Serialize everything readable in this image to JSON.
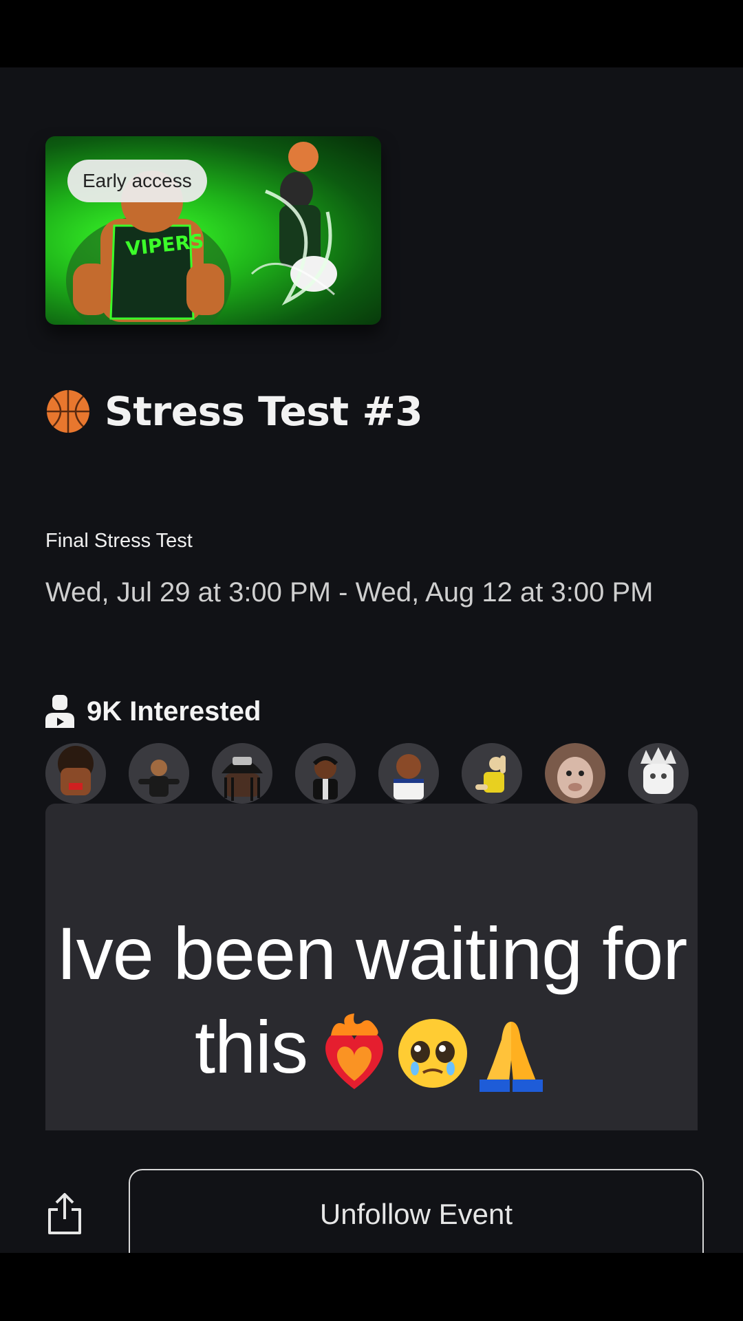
{
  "event": {
    "badge": "Early access",
    "title": "Stress Test #3",
    "title_icon": "basketball-icon",
    "subtitle": "Final Stress Test",
    "date_range": "Wed, Jul 29 at 3:00 PM - Wed, Aug 12 at 3:00 PM",
    "thumbnail_text": "VIPERS"
  },
  "interested": {
    "icon": "person-icon",
    "label": "9K Interested",
    "avatar_count": 8
  },
  "comment": {
    "text": "Ive been waiting for this",
    "emojis": [
      "heart-on-fire-icon",
      "pleading-face-icon",
      "folded-hands-icon"
    ]
  },
  "actions": {
    "share_icon": "share-icon",
    "unfollow_label": "Unfollow Event"
  },
  "colors": {
    "background": "#111216",
    "card": "#2a2a2f",
    "accent_green": "#3cff2a"
  }
}
